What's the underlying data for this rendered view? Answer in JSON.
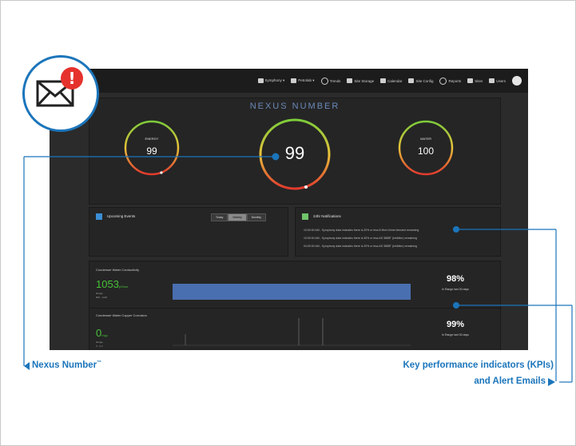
{
  "topbar": {
    "items": [
      "Symphony ▾",
      "Petrolab ▾",
      "Trends",
      "Site Storage",
      "Calendar",
      "Site Config",
      "Reports",
      "Sites",
      "Users"
    ]
  },
  "nexus": {
    "title": "NEXUS NUMBER",
    "gauges": [
      {
        "label": "ENERGY",
        "value": "99"
      },
      {
        "label": "",
        "value": "99"
      },
      {
        "label": "WATER",
        "value": "100"
      }
    ]
  },
  "events": {
    "title": "Upcoming Events",
    "buttons": [
      "Today",
      "Weekly",
      "Monthly"
    ],
    "active": "Weekly"
  },
  "notifications": {
    "title": "24hr Notifications",
    "items": [
      "10:00:00 AM - Symphony data indicates there is 20% or less 8.9hrm Brine blended remaining",
      "10:00:00 AM - Symphony data indicates there is 30% or less AS 3888T (Inhibitor) remaining",
      "04:00:00 AM - Symphony data indicates there is 20% or less AS 3888T (Inhibitor) remaining"
    ]
  },
  "kpis": [
    {
      "name": "Condenser Water Conductivity",
      "value": "1053",
      "unit": "µS/cm",
      "small1": "Range",
      "small2": "800 - 1100",
      "pct": "98%",
      "sub": "In Range last 30 days"
    },
    {
      "name": "Condenser Water Copper Corrosion",
      "value": "0",
      "unit": "mpy",
      "small1": "Range",
      "small2": "0 - 0.2",
      "pct": "99%",
      "sub": "In Range last 30 days"
    }
  ],
  "callouts": {
    "left": "Nexus Number",
    "left_tm": "™",
    "right_line1": "Key performance indicators (KPIs)",
    "right_line2": "and Alert Emails"
  },
  "colors": {
    "accent": "#1b75bb",
    "alert": "#e5322d",
    "kpi_green": "#49c23a",
    "bar_blue": "#4a6fb0"
  }
}
